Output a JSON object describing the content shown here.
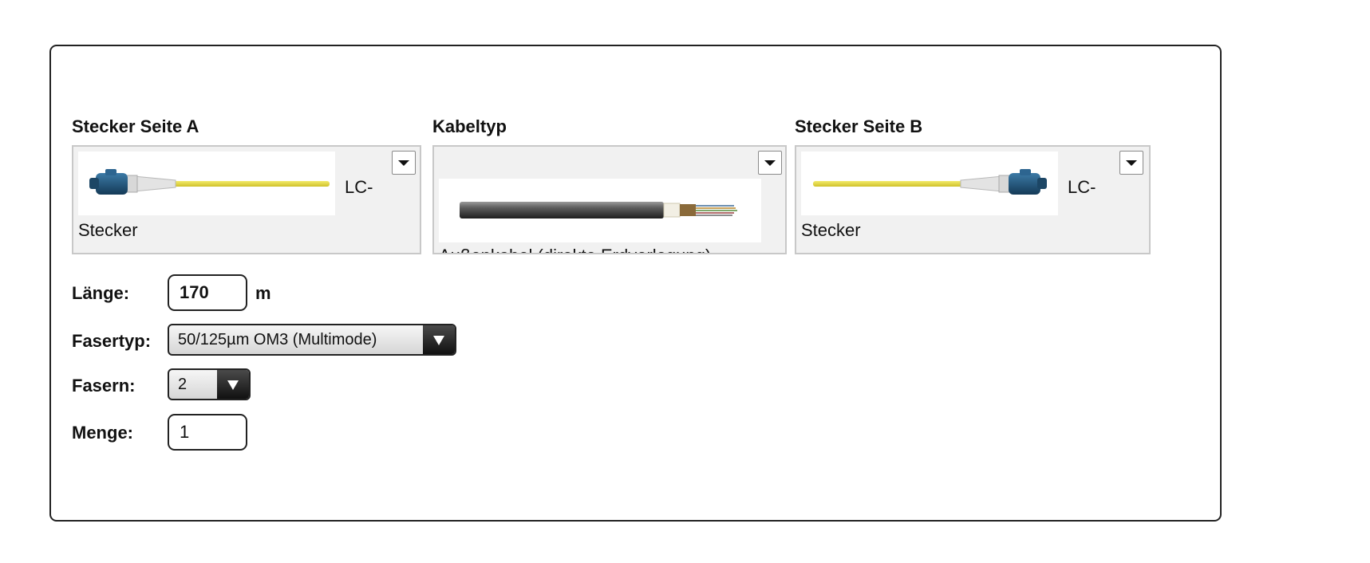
{
  "connector_a": {
    "heading": "Stecker Seite A",
    "name": "LC-Stecker",
    "name_line1": "LC-",
    "name_line2": "Stecker"
  },
  "cable_type": {
    "heading": "Kabeltyp",
    "name": "Außenkabel (direkte Erdverlegung)"
  },
  "connector_b": {
    "heading": "Stecker Seite B",
    "name": "LC-Stecker",
    "name_line1": "LC-",
    "name_line2": "Stecker"
  },
  "length": {
    "label": "Länge:",
    "value": "170",
    "unit": "m"
  },
  "fiber_type": {
    "label": "Fasertyp:",
    "selected": "50/125µm OM3 (Multimode)"
  },
  "fibers": {
    "label": "Fasern:",
    "selected": "2"
  },
  "quantity": {
    "label": "Menge:",
    "value": "1"
  },
  "icons": {
    "dropdown": "triangle-down-icon",
    "connector_image": "lc-connector-image",
    "cable_image": "outdoor-cable-image"
  },
  "colors": {
    "connector_blue": "#1f4f73",
    "fiber_yellow": "#e8dc3a",
    "panel_border": "#222222",
    "selector_bg": "#f1f1f1"
  }
}
